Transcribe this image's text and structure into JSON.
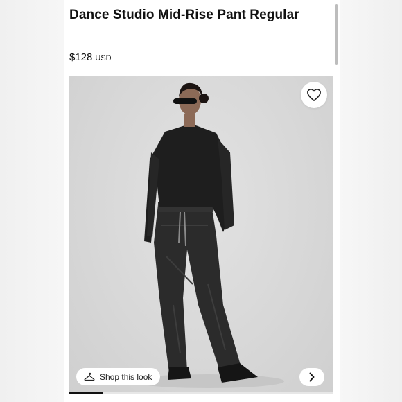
{
  "product": {
    "title": "Dance Studio Mid-Rise Pant Regular",
    "price": "$128",
    "currency": "USD"
  },
  "image": {
    "wishlist_icon": "heart-icon",
    "shop_look_label": "Shop this look",
    "shop_look_icon": "hanger-icon",
    "next_icon": "chevron-right-icon",
    "carousel_progress": 0.13
  },
  "colors": {
    "text": "#111111",
    "image_background": "#d9d9d9",
    "progress": "#111111"
  }
}
